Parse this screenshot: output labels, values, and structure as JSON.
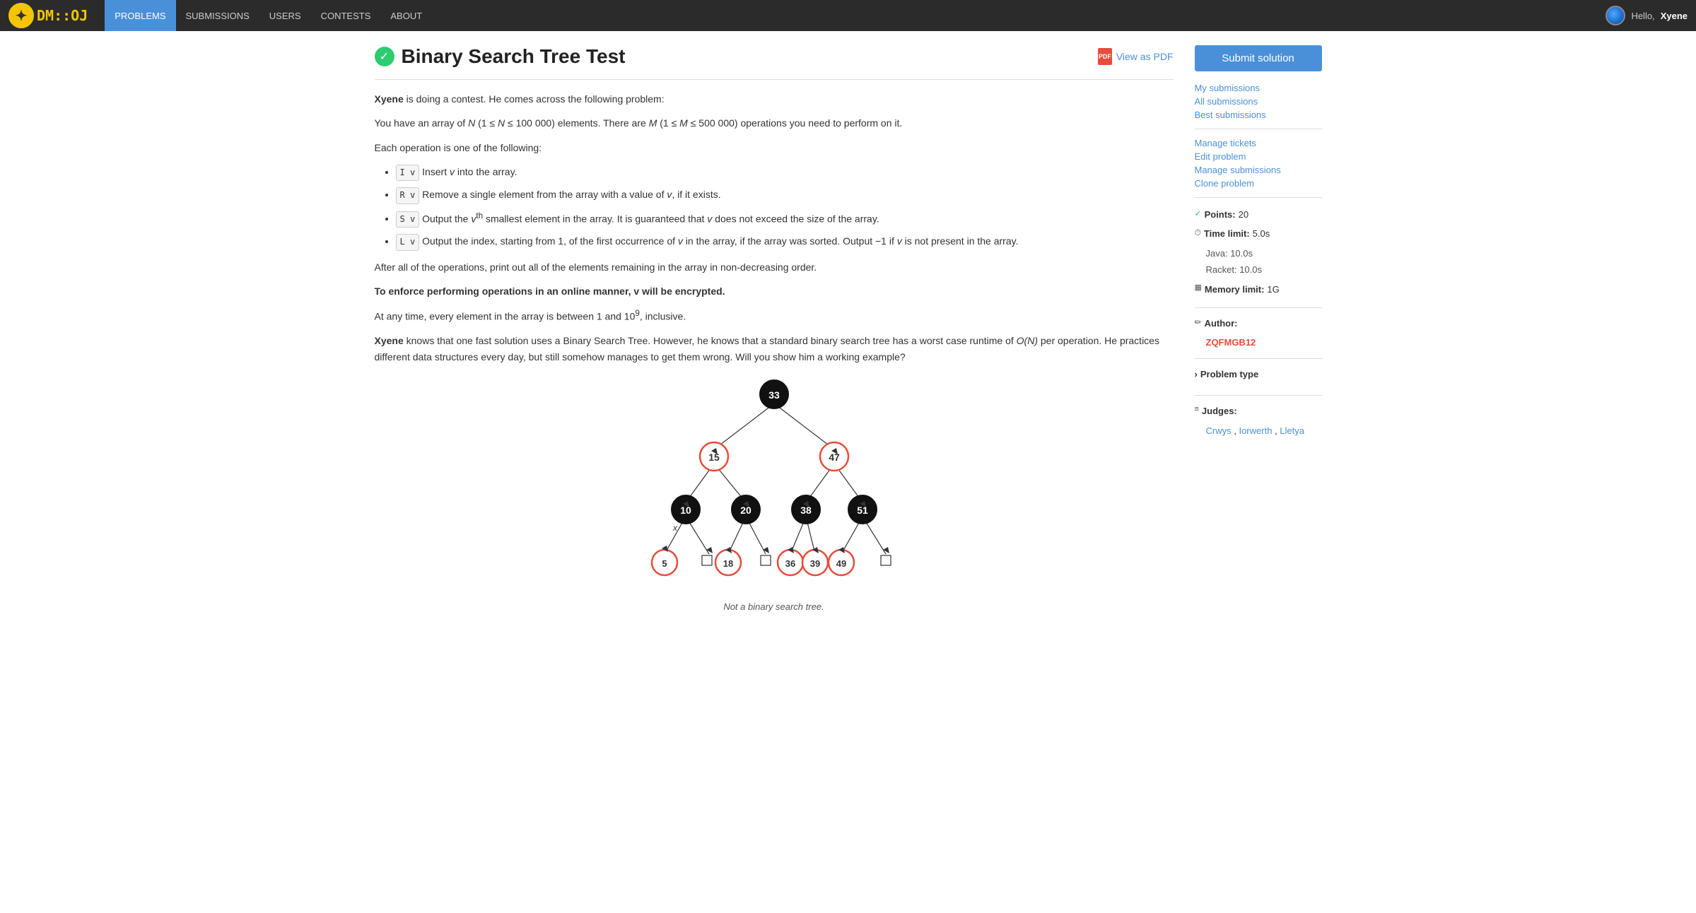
{
  "nav": {
    "logo_text": "DM::OJ",
    "links": [
      {
        "label": "PROBLEMS",
        "active": true
      },
      {
        "label": "SUBMISSIONS",
        "active": false
      },
      {
        "label": "USERS",
        "active": false
      },
      {
        "label": "CONTESTS",
        "active": false
      },
      {
        "label": "ABOUT",
        "active": false
      }
    ],
    "user_greeting": "Hello, ",
    "username": "Xyene"
  },
  "problem": {
    "title": "Binary Search Tree Test",
    "pdf_link_label": "View as PDF",
    "intro_name": "Xyene",
    "intro_text": " is doing a contest. He comes across the following problem:",
    "para1": "You have an array of N (1 ≤ N ≤ 100 000) elements. There are M (1 ≤ M ≤ 500 000) operations you need to perform on it.",
    "para2": "Each operation is one of the following:",
    "ops": [
      {
        "kbd": "I v",
        "text": "Insert v into the array."
      },
      {
        "kbd": "R v",
        "text": "Remove a single element from the array with a value of v, if it exists."
      },
      {
        "kbd": "S v",
        "text": "Output the vᵗʰ smallest element in the array. It is guaranteed that v does not exceed the size of the array."
      },
      {
        "kbd": "L v",
        "text": "Output the index, starting from 1, of the first occurrence of v in the array, if the array was sorted. Output −1 if v is not present in the array."
      }
    ],
    "para3": "After all of the operations, print out all of the elements remaining in the array in non-decreasing order.",
    "para4": "To enforce performing operations in an online manner, v will be encrypted.",
    "para5": "At any time, every element in the array is between 1 and 10⁹, inclusive.",
    "para6_name": "Xyene",
    "para6_text": " knows that one fast solution uses a Binary Search Tree. However, he knows that a standard binary search tree has a worst case runtime of O(N) per operation. He practices different data structures every day, but still somehow manages to get them wrong. Will you show him a working example?",
    "bst_caption": "Not a binary search tree."
  },
  "sidebar": {
    "submit_label": "Submit solution",
    "my_submissions": "My submissions",
    "all_submissions": "All submissions",
    "best_submissions": "Best submissions",
    "manage_tickets": "Manage tickets",
    "edit_problem": "Edit problem",
    "manage_submissions": "Manage submissions",
    "clone_problem": "Clone problem",
    "points_label": "Points:",
    "points_value": "20",
    "time_limit_label": "Time limit:",
    "time_limit_value": "5.0s",
    "java_label": "Java:",
    "java_value": "10.0s",
    "racket_label": "Racket:",
    "racket_value": "10.0s",
    "memory_limit_label": "Memory limit:",
    "memory_limit_value": "1G",
    "author_label": "Author:",
    "author_name": "ZQFMGB12",
    "problem_type_label": "Problem type",
    "judges_label": "Judges:",
    "judge1": "Crwys",
    "judge2": "Iorwerth",
    "judge3": "Lletya"
  }
}
